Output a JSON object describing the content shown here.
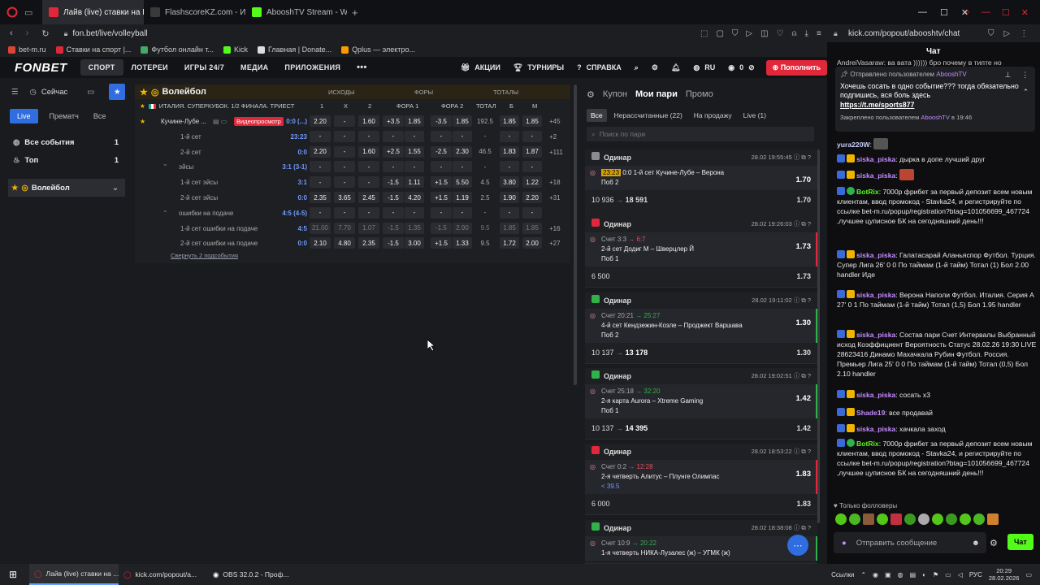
{
  "browser": {
    "tabs": [
      {
        "label": "Лайв (live) ставки на Вол",
        "color": "#e0283a",
        "active": true
      },
      {
        "label": "FlashscoreKZ.com - Избр",
        "color": "#2b2b2b",
        "active": false
      },
      {
        "label": "AbooshTV Stream - Watch",
        "color": "#53fc18",
        "active": false
      }
    ],
    "url_left": "fon.bet/live/volleyball",
    "url_right": "kick.com/popout/abooshtv/chat",
    "bookmarks": [
      "bet-m.ru",
      "Ставки на спорт |...",
      "Футбол онлайн т...",
      "Kick",
      "Главная | Donate...",
      "Qplus — электро..."
    ]
  },
  "fonbet": {
    "logo": "FONBET",
    "nav": [
      "СПОРТ",
      "ЛОТЕРЕИ",
      "ИГРЫ 24/7",
      "МЕДИА",
      "ПРИЛОЖЕНИЯ"
    ],
    "nav_more": "•••",
    "right_nav": [
      "АКЦИИ",
      "ТУРНИРЫ",
      "СПРАВКА"
    ],
    "lang": "RU",
    "balance": "0",
    "topup": "Пополнить",
    "sidebar": {
      "now_label": "Сейчас",
      "tabs": [
        "Live",
        "Прематч",
        "Все"
      ],
      "items": [
        {
          "label": "Все события",
          "count": "1"
        },
        {
          "label": "Топ",
          "count": "1"
        }
      ],
      "sport": "Волейбол"
    },
    "event": {
      "sport_title": "Волейбол",
      "col_groups": [
        "ИСХОДЫ",
        "ФОРЫ",
        "ТОТАЛЫ"
      ],
      "league": "ИТАЛИЯ. СУПЕРКУБОК. 1/2 ФИНАЛА. ТРИЕСТ",
      "col_heads": [
        "1",
        "Х",
        "2",
        "ФОРА 1",
        "ФОРА 2",
        "ТОТАЛ",
        "Б",
        "М"
      ],
      "rows": [
        {
          "name": "Кучине-Лубе ...",
          "badge": "Видеопросмотр",
          "score": "0:0 (...)",
          "c": [
            "2.20",
            "-",
            "1.60",
            "+3.5",
            "1.85",
            "-3.5",
            "1.85",
            "192.5",
            "1.85",
            "1.85"
          ],
          "more": "+45"
        },
        {
          "name": "1-й сет",
          "score": "23:23",
          "c": [
            "-",
            "-",
            "-",
            "-",
            "-",
            "-",
            "-",
            "-",
            "-",
            "-"
          ],
          "more": "+2"
        },
        {
          "name": "2-й сет",
          "score": "0:0",
          "c": [
            "2.20",
            "-",
            "1.60",
            "+2.5",
            "1.55",
            "-2.5",
            "2.30",
            "46.5",
            "1.83",
            "1.87"
          ],
          "more": "+111"
        },
        {
          "name": "эйсы",
          "score": "3:1 (3-1)",
          "c": [
            "-",
            "-",
            "-",
            "-",
            "-",
            "-",
            "-",
            "-",
            "-",
            "-"
          ],
          "more": ""
        },
        {
          "name": "1-й сет эйсы",
          "score": "3:1",
          "c": [
            "-",
            "-",
            "-",
            "-1.5",
            "1.11",
            "+1.5",
            "5.50",
            "4.5",
            "3.80",
            "1.22"
          ],
          "more": "+18"
        },
        {
          "name": "2-й сет эйсы",
          "score": "0:0",
          "c": [
            "2.35",
            "3.65",
            "2.45",
            "-1.5",
            "4.20",
            "+1.5",
            "1.19",
            "2.5",
            "1.90",
            "2.20"
          ],
          "more": "+31"
        },
        {
          "name": "ошибки на подаче",
          "score": "4:5 (4-5)",
          "c": [
            "-",
            "-",
            "-",
            "-",
            "-",
            "-",
            "-",
            "-",
            "-",
            "-"
          ],
          "more": ""
        },
        {
          "name": "1-й сет ошибки на подаче",
          "score": "4:5",
          "c": [
            "21.00",
            "7.70",
            "1.07",
            "-1.5",
            "1.35",
            "-1.5",
            "2.90",
            "9.5",
            "1.85",
            "1.85"
          ],
          "more": "+16"
        },
        {
          "name": "2-й сет ошибки на подаче",
          "score": "0:0",
          "c": [
            "2.10",
            "4.80",
            "2.35",
            "-1.5",
            "3.00",
            "+1.5",
            "1.33",
            "9.5",
            "1.72",
            "2.00"
          ],
          "more": "+27"
        }
      ],
      "collapse": "Свернуть 2 подсобытия"
    },
    "bets": {
      "tabs": [
        "Купон",
        "Мои пари",
        "Промо"
      ],
      "filters": [
        "Все",
        "Нерассчитанные (22)",
        "На продажу",
        "Live (1)"
      ],
      "search_placeholder": "Поиск по пари",
      "cards": [
        {
          "type": "Одинар",
          "status": "pending",
          "date": "28.02",
          "time": "19:55:45",
          "score_prefix": "23:23",
          "score_arrow": "",
          "event": "0:0 1-й сет Кучине-Лубе – Верона",
          "outcome": "Поб 2",
          "coef": "1.70",
          "stake": "10 936",
          "payout": "18 591",
          "total": "1.70"
        },
        {
          "type": "Одинар",
          "status": "lost",
          "date": "28.02",
          "time": "19:26:03",
          "score_prefix": "Счет 3:3",
          "score_arrow": "→ 6:7",
          "event": "2-й сет Додиг М – Шверцлер Й",
          "outcome": "Поб 1",
          "coef": "1.73",
          "stake": "6 500",
          "payout": "",
          "total": "1.73"
        },
        {
          "type": "Одинар",
          "status": "won",
          "date": "28.02",
          "time": "19:11:02",
          "score_prefix": "Счет 20:21",
          "score_arrow": "→ 25:27",
          "event": "4-й сет Кендзежин-Козле – Проджект Варшава",
          "outcome": "Поб 2",
          "coef": "1.30",
          "stake": "10 137",
          "payout": "13 178",
          "total": "1.30"
        },
        {
          "type": "Одинар",
          "status": "won",
          "date": "28.02",
          "time": "19:02:51",
          "score_prefix": "Счет 25:18",
          "score_arrow": "→ 32:20",
          "event": "2-я карта Aurora – Xtreme Gaming",
          "outcome": "Поб 1",
          "coef": "1.42",
          "stake": "10 137",
          "payout": "14 395",
          "total": "1.42"
        },
        {
          "type": "Одинар",
          "status": "lost",
          "date": "28.02",
          "time": "18:53:22",
          "score_prefix": "Счет 0:2",
          "score_arrow": "→ 12:28",
          "event": "2-я четверть Алитус – Плунге Олимпас",
          "outcome": "< 39.5",
          "coef": "1.83",
          "stake": "6 000",
          "payout": "",
          "total": "1.83"
        },
        {
          "type": "Одинар",
          "status": "won",
          "date": "28.02",
          "time": "18:38:08",
          "score_prefix": "Счет 10:9",
          "score_arrow": "→ 20:22",
          "event": "1-я четверть НИКА-Лузалес (ж) – УГМК (ж)",
          "outcome": "",
          "coef": "",
          "stake": "",
          "payout": "",
          "total": ""
        }
      ]
    }
  },
  "chat": {
    "title": "Чат",
    "top_partial": "AndreiVasaraw: ва вата )))))) бро почему в типте но",
    "pinned_by": "Отправлено пользователем",
    "pinned_user": "AbooshTV",
    "pinned_text": "Хочешь сосать в одно событие??? тогда обязательно подпишись, вся боль здесь",
    "pinned_link": "https://t.me/sports877",
    "pinned_footer": "Закреплено пользователем",
    "pinned_footer_user": "AbooshTV",
    "pinned_time": "в 19:46",
    "messages": [
      {
        "nick": "yura220W",
        "color": "#c8d0ff",
        "text": ""
      },
      {
        "nick": "siska_piska",
        "color": "#c48cff",
        "text": "дырка в допе лучший друг"
      },
      {
        "nick": "siska_piska",
        "color": "#c48cff",
        "text": ""
      },
      {
        "nick": "BotRix",
        "color": "#53fc18",
        "text": "7000р фрибет за первый депозит всем новым клиентам, ввод промокод - Stavka24, и регистрируйте по ссылке bet-m.ru/popup/registration?btag=101056699_467724 ,лучшее цуписное БК на сегодняшний день!!!"
      },
      {
        "nick": "siska_piska",
        "color": "#c48cff",
        "text": "Галатасарай Аланьяспор Футбол. Турция. Супер Лига 26' 0 0 По таймам (1-й тайм) Тотал (1) Бол 2.00 handler Иде"
      },
      {
        "nick": "siska_piska",
        "color": "#c48cff",
        "text": "Верона Наполи Футбол. Италия. Серия A 27' 0 1 По таймам (1-й тайм) Тотал (1,5) Бол 1.95 handler"
      },
      {
        "nick": "siska_piska",
        "color": "#c48cff",
        "text": "Состав пари Счет Интервалы Выбранный исход Коэффициент Вероятность Статус 28.02.26 19:30 LIVE 28623416 Динамо Махачкала Рубин Футбол. Россия. Премьер Лига 25' 0 0 По таймам (1-й тайм) Тотал (0,5) Бол 2.10 handler"
      },
      {
        "nick": "siska_piska",
        "color": "#c48cff",
        "text": "сосать х3"
      },
      {
        "nick": "Shade19",
        "color": "#c48cff",
        "text": "все продавай"
      },
      {
        "nick": "siska_piska",
        "color": "#c48cff",
        "text": "хачкала заход"
      },
      {
        "nick": "BotRix",
        "color": "#53fc18",
        "text": "7000р фрибет за первый депозит всем новым клиентам, ввод промокод - Stavka24, и регистрируйте по ссылке bet-m.ru/popup/registration?btag=101056699_467724 ,лучшее цуписное БК на сегодняшний день!!!"
      }
    ],
    "followers_only": "Только фолловеры",
    "input_placeholder": "Отправить сообщение",
    "send": "Чат"
  },
  "taskbar": {
    "items": [
      "Лайв (live) ставки на ...",
      "kick.com/popout/a...",
      "OBS 32.0.2 - Проф..."
    ],
    "links": "Ссылки",
    "lang": "РУС",
    "time": "20:29",
    "date": "28.02.2026"
  },
  "colors": {
    "accent": "#e0283a",
    "kick": "#53fc18",
    "won": "#2fb24a",
    "lost": "#e0283a",
    "pending": "#8a8b90"
  }
}
